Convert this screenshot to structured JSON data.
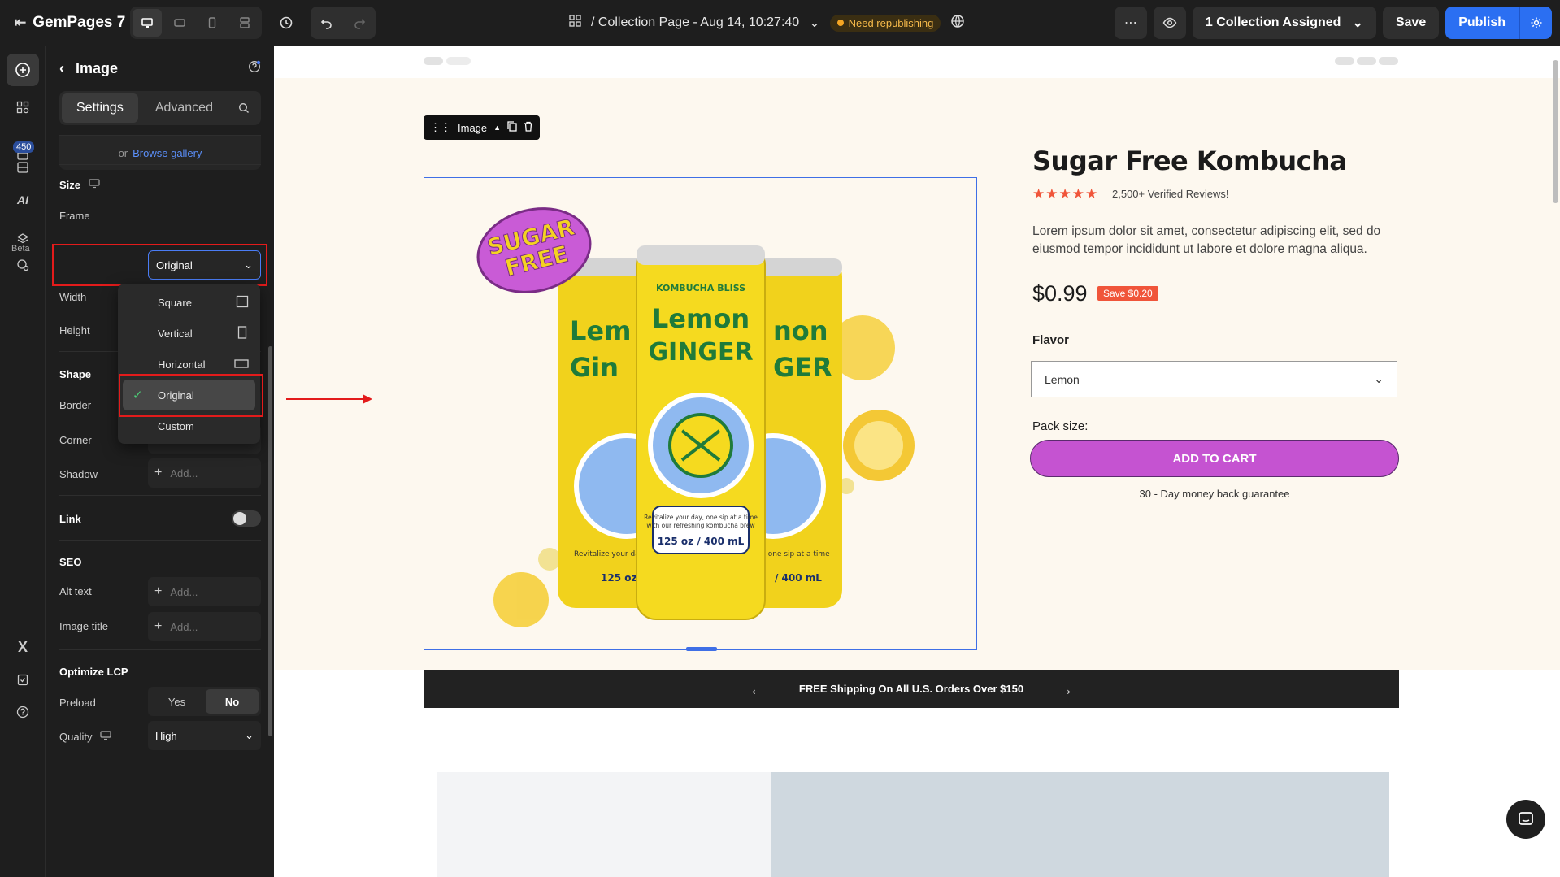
{
  "topbar": {
    "app_name": "GemPages 7",
    "page_title": "/ Collection Page - Aug 14, 10:27:40",
    "republish_badge": "Need republishing",
    "assigned": "1 Collection Assigned",
    "save": "Save",
    "publish": "Publish"
  },
  "rail": {
    "badge_count": "450",
    "beta": "Beta"
  },
  "sidebar": {
    "title": "Image",
    "tabs": [
      "Settings",
      "Advanced"
    ],
    "gallery_or": "or",
    "gallery_link": "Browse gallery",
    "size_title": "Size",
    "frame_label": "Frame",
    "frame_value": "Original",
    "width_label": "Width",
    "height_label": "Height",
    "shape_title": "Shape",
    "border_label": "Border",
    "corner_label": "Corner",
    "shadow_label": "Shadow",
    "add_placeholder": "Add...",
    "link_title": "Link",
    "seo_title": "SEO",
    "alt_label": "Alt text",
    "image_title_label": "Image title",
    "lcp_title": "Optimize LCP",
    "preload_label": "Preload",
    "preload_yes": "Yes",
    "preload_no": "No",
    "quality_label": "Quality",
    "quality_value": "High"
  },
  "frame_dropdown": {
    "options": [
      "Square",
      "Vertical",
      "Horizontal",
      "Original",
      "Custom"
    ],
    "selected": "Original"
  },
  "canvas": {
    "image_toolbar_label": "Image",
    "product": {
      "title": "Sugar Free Kombucha",
      "stars": "★★★★★",
      "reviews": "2,500+ Verified Reviews!",
      "description": "Lorem ipsum dolor sit amet, consectetur adipiscing elit, sed do eiusmod tempor incididunt ut labore et dolore magna aliqua.",
      "price": "$0.99",
      "save_badge": "Save $0.20",
      "flavor_label": "Flavor",
      "flavor_value": "Lemon",
      "pack_label": "Pack size:",
      "cart_button": "ADD TO CART",
      "guarantee": "30 - Day money back guarantee"
    },
    "cans": {
      "sticker_line1": "SUGAR",
      "sticker_line2": "FREE",
      "brand": "KOMBUCHA BLISS",
      "flavor_line1": "Lemon",
      "flavor_line2": "GINGER",
      "left_flavor_line1": "Lem",
      "left_flavor_line2": "Gin",
      "right_flavor_line1": "non",
      "right_flavor_line2": "GER",
      "tagline_line1": "Revitalize your day, one sip at a time",
      "tagline_line2": "with our refreshing kombucha brew",
      "volume": "125 oz / 400 mL",
      "side_volume": "/ 400 mL",
      "left_volume": "125 oz /",
      "left_tagline": "Revitalize your day,",
      "right_tagline": ", one sip at a time"
    },
    "shipping_banner": "FREE Shipping On All U.S. Orders Over $150"
  },
  "colors": {
    "accent_blue": "#2b6ff2",
    "annotation_red": "#e31b1b",
    "cart_purple": "#c553d1",
    "star_orange": "#f0553a",
    "hero_bg": "#fdf8ef"
  }
}
